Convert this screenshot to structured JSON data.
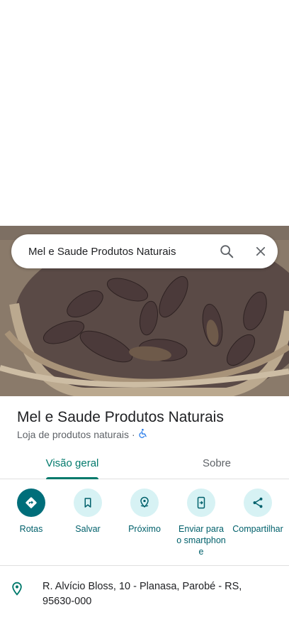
{
  "search": {
    "query": "Mel e Saude Produtos Naturais"
  },
  "place": {
    "name": "Mel e Saude Produtos Naturais",
    "category": "Loja de produtos naturais",
    "separator": "·"
  },
  "tabs": [
    {
      "label": "Visão geral",
      "active": true
    },
    {
      "label": "Sobre",
      "active": false
    }
  ],
  "actions": [
    {
      "label": "Rotas",
      "icon": "directions-icon"
    },
    {
      "label": "Salvar",
      "icon": "bookmark-icon"
    },
    {
      "label": "Próximo",
      "icon": "nearby-icon"
    },
    {
      "label": "Enviar para o smartphone",
      "icon": "send-to-phone-icon"
    },
    {
      "label": "Compartilhar",
      "icon": "share-icon"
    }
  ],
  "address": {
    "text": "R. Alvício Bloss, 10 - Planasa, Parobé - RS, 95630-000"
  },
  "colors": {
    "accent": "#00796b",
    "action_bg": "#d7f2f4",
    "primary_action": "#006e7a"
  }
}
